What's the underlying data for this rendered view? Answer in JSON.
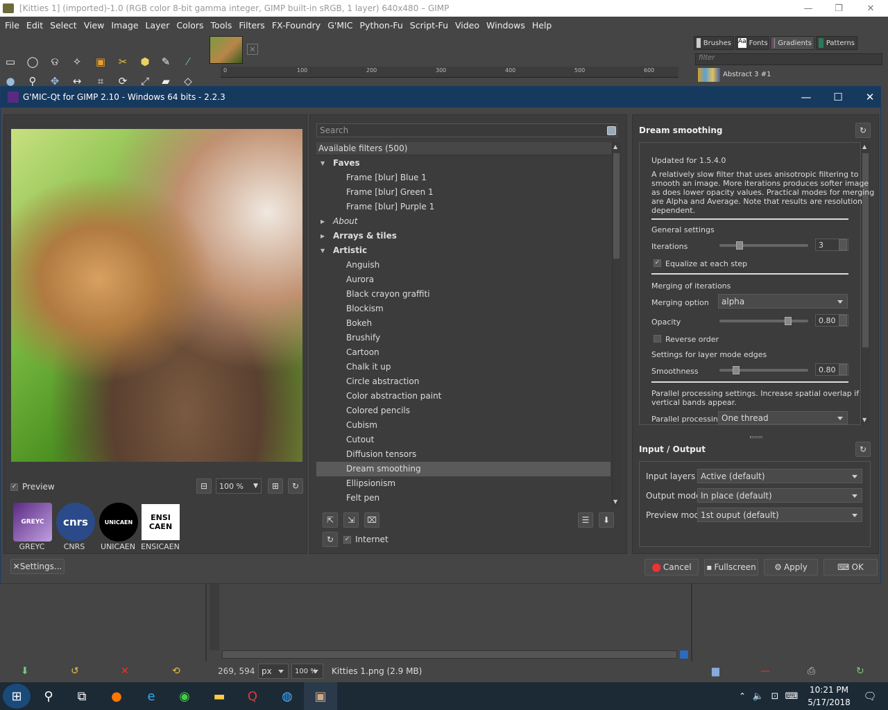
{
  "gimp_title": "[Kitties 1] (imported)-1.0 (RGB color 8-bit gamma integer, GIMP built-in sRGB, 1 layer) 640x480 – GIMP",
  "gimp_menu": [
    "File",
    "Edit",
    "Select",
    "View",
    "Image",
    "Layer",
    "Colors",
    "Tools",
    "Filters",
    "FX-Foundry",
    "G'MIC",
    "Python-Fu",
    "Script-Fu",
    "Video",
    "Windows",
    "Help"
  ],
  "ruler_ticks": [
    "0",
    "100",
    "200",
    "300",
    "400",
    "500",
    "600"
  ],
  "dock_tabs": [
    "Brushes",
    "Fonts",
    "Gradients",
    "Patterns"
  ],
  "dock_filter_placeholder": "filter",
  "gradient_name": "Abstract 3 #1",
  "gmic_title": "G'MIC-Qt for GIMP 2.10 - Windows 64 bits - 2.2.3",
  "preview": {
    "label": "Preview",
    "zoom": "100 %"
  },
  "logos": [
    {
      "text": "GREYC",
      "label": "GREYC"
    },
    {
      "text": "cnrs",
      "label": "CNRS"
    },
    {
      "text": "UNICAEN",
      "label": "UNICAEN"
    },
    {
      "text": "ENSI CAEN",
      "label": "ENSICAEN"
    }
  ],
  "settings_btn": "Settings...",
  "search_placeholder": "Search",
  "filters_header": "Available filters (500)",
  "filters": [
    {
      "t": "Faves",
      "kind": "cat",
      "open": true
    },
    {
      "t": "Frame [blur] Blue 1",
      "kind": "item"
    },
    {
      "t": "Frame [blur] Green 1",
      "kind": "item"
    },
    {
      "t": "Frame [blur] Purple 1",
      "kind": "item"
    },
    {
      "t": "About",
      "kind": "cat",
      "open": false,
      "italic": true
    },
    {
      "t": "Arrays & tiles",
      "kind": "cat",
      "open": false
    },
    {
      "t": "Artistic",
      "kind": "cat",
      "open": true
    },
    {
      "t": "Anguish",
      "kind": "item"
    },
    {
      "t": "Aurora",
      "kind": "item"
    },
    {
      "t": "Black crayon graffiti",
      "kind": "item"
    },
    {
      "t": "Blockism",
      "kind": "item"
    },
    {
      "t": "Bokeh",
      "kind": "item"
    },
    {
      "t": "Brushify",
      "kind": "item"
    },
    {
      "t": "Cartoon",
      "kind": "item"
    },
    {
      "t": "Chalk it up",
      "kind": "item"
    },
    {
      "t": "Circle abstraction",
      "kind": "item"
    },
    {
      "t": "Color abstraction paint",
      "kind": "item"
    },
    {
      "t": "Colored pencils",
      "kind": "item"
    },
    {
      "t": "Cubism",
      "kind": "item"
    },
    {
      "t": "Cutout",
      "kind": "item"
    },
    {
      "t": "Diffusion tensors",
      "kind": "item"
    },
    {
      "t": "Dream smoothing",
      "kind": "item",
      "selected": true
    },
    {
      "t": "Ellipsionism",
      "kind": "item"
    },
    {
      "t": "Felt pen",
      "kind": "item"
    }
  ],
  "internet_label": "Internet",
  "filter_name": "Dream smoothing",
  "params": {
    "updated": "Updated for 1.5.4.0",
    "desc": [
      "A relatively slow filter that uses anisotropic filtering to",
      "smooth an image. More iterations produces softer image",
      "as does lower opacity values. Practical modes for merging",
      "are Alpha and Average. Note that results are resolution",
      "dependent."
    ],
    "general": "General settings",
    "iterations_label": "Iterations",
    "iterations_val": "3",
    "iterations_level": 0.2,
    "equalize": "Equalize at each step",
    "merging_hdr": "Merging of iterations",
    "merging_label": "Merging option",
    "merging_val": "alpha",
    "opacity_label": "Opacity",
    "opacity_val": "0.80",
    "reverse": "Reverse order",
    "layer_hdr": "Settings for layer mode edges",
    "smooth_label": "Smoothness",
    "smooth_val": "0.80",
    "parallel_desc": [
      "Parallel processing settings. Increase spatial overlap if",
      "vertical bands appear."
    ],
    "parallel_label": "Parallel processing",
    "parallel_val": "One thread"
  },
  "io": {
    "title": "Input / Output",
    "rows": [
      {
        "label": "Input layers",
        "value": "Active (default)"
      },
      {
        "label": "Output mode",
        "value": "In place (default)"
      },
      {
        "label": "Preview mode",
        "value": "1st ouput (default)"
      }
    ]
  },
  "buttons": {
    "cancel": "Cancel",
    "fullscreen": "Fullscreen",
    "apply": "Apply",
    "ok": "OK"
  },
  "status": {
    "coords": "269, 594",
    "unit": "px",
    "zoom": "100 %",
    "file": "Kitties 1.png (2.9 MB)"
  },
  "clock": {
    "time": "10:21 PM",
    "date": "5/17/2018"
  }
}
